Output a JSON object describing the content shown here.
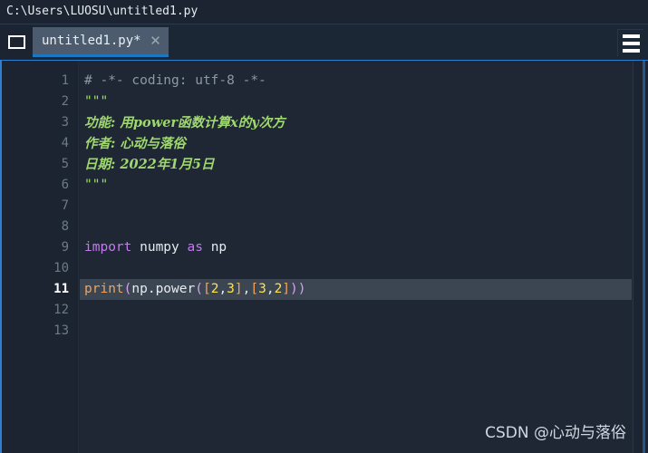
{
  "window": {
    "title": "C:\\Users\\LUOSU\\untitled1.py"
  },
  "tabbar": {
    "folder_icon": "folder-icon",
    "menu_icon": "hamburger-menu-icon",
    "tabs": [
      {
        "label": "untitled1.py*",
        "close_glyph": "✕",
        "active": true
      }
    ]
  },
  "editor": {
    "current_line": 11,
    "gutter_numbers": [
      "1",
      "2",
      "3",
      "4",
      "5",
      "6",
      "7",
      "8",
      "9",
      "10",
      "11",
      "12",
      "13"
    ],
    "lines": [
      {
        "n": 1,
        "tokens": [
          {
            "t": "comment",
            "s": "# -*- coding: utf-8 -*-"
          }
        ]
      },
      {
        "n": 2,
        "tokens": [
          {
            "t": "doc",
            "s": "\"\"\""
          }
        ]
      },
      {
        "n": 3,
        "tokens": [
          {
            "t": "doc-cn",
            "s": "功能: 用power函数计算x的y次方"
          }
        ]
      },
      {
        "n": 4,
        "tokens": [
          {
            "t": "doc-cn",
            "s": "作者: 心动与落俗"
          }
        ]
      },
      {
        "n": 5,
        "tokens": [
          {
            "t": "doc-cn",
            "s": "日期: 2022年1月5日"
          }
        ]
      },
      {
        "n": 6,
        "tokens": [
          {
            "t": "doc",
            "s": "\"\"\""
          }
        ]
      },
      {
        "n": 7,
        "tokens": []
      },
      {
        "n": 8,
        "tokens": []
      },
      {
        "n": 9,
        "tokens": [
          {
            "t": "kw",
            "s": "import"
          },
          {
            "t": "plain",
            "s": " numpy "
          },
          {
            "t": "kw",
            "s": "as"
          },
          {
            "t": "plain",
            "s": " np"
          }
        ]
      },
      {
        "n": 10,
        "tokens": []
      },
      {
        "n": 11,
        "tokens": [
          {
            "t": "fn",
            "s": "print"
          },
          {
            "t": "paren",
            "s": "("
          },
          {
            "t": "plain",
            "s": "np.power"
          },
          {
            "t": "paren",
            "s": "("
          },
          {
            "t": "bracket",
            "s": "["
          },
          {
            "t": "num",
            "s": "2"
          },
          {
            "t": "punc",
            "s": ","
          },
          {
            "t": "num",
            "s": "3"
          },
          {
            "t": "bracket",
            "s": "]"
          },
          {
            "t": "punc",
            "s": ","
          },
          {
            "t": "bracket",
            "s": "["
          },
          {
            "t": "num",
            "s": "3"
          },
          {
            "t": "punc",
            "s": ","
          },
          {
            "t": "num",
            "s": "2"
          },
          {
            "t": "bracket",
            "s": "]"
          },
          {
            "t": "paren",
            "s": ")"
          },
          {
            "t": "paren",
            "s": ")"
          }
        ]
      },
      {
        "n": 12,
        "tokens": []
      },
      {
        "n": 13,
        "tokens": []
      }
    ]
  },
  "watermark": {
    "text": "CSDN @心动与落俗"
  },
  "colors": {
    "background": "#1e2733",
    "gutter": "#1b2430",
    "accent": "#2f7fd0",
    "tab_active": "#4c5c6e",
    "current_line": "#3b4652",
    "comment": "#8c99a6",
    "docstring": "#9fd86f",
    "keyword": "#c678f0",
    "function": "#f0a35e",
    "number": "#ffe04d",
    "plain": "#e6ebf0"
  }
}
